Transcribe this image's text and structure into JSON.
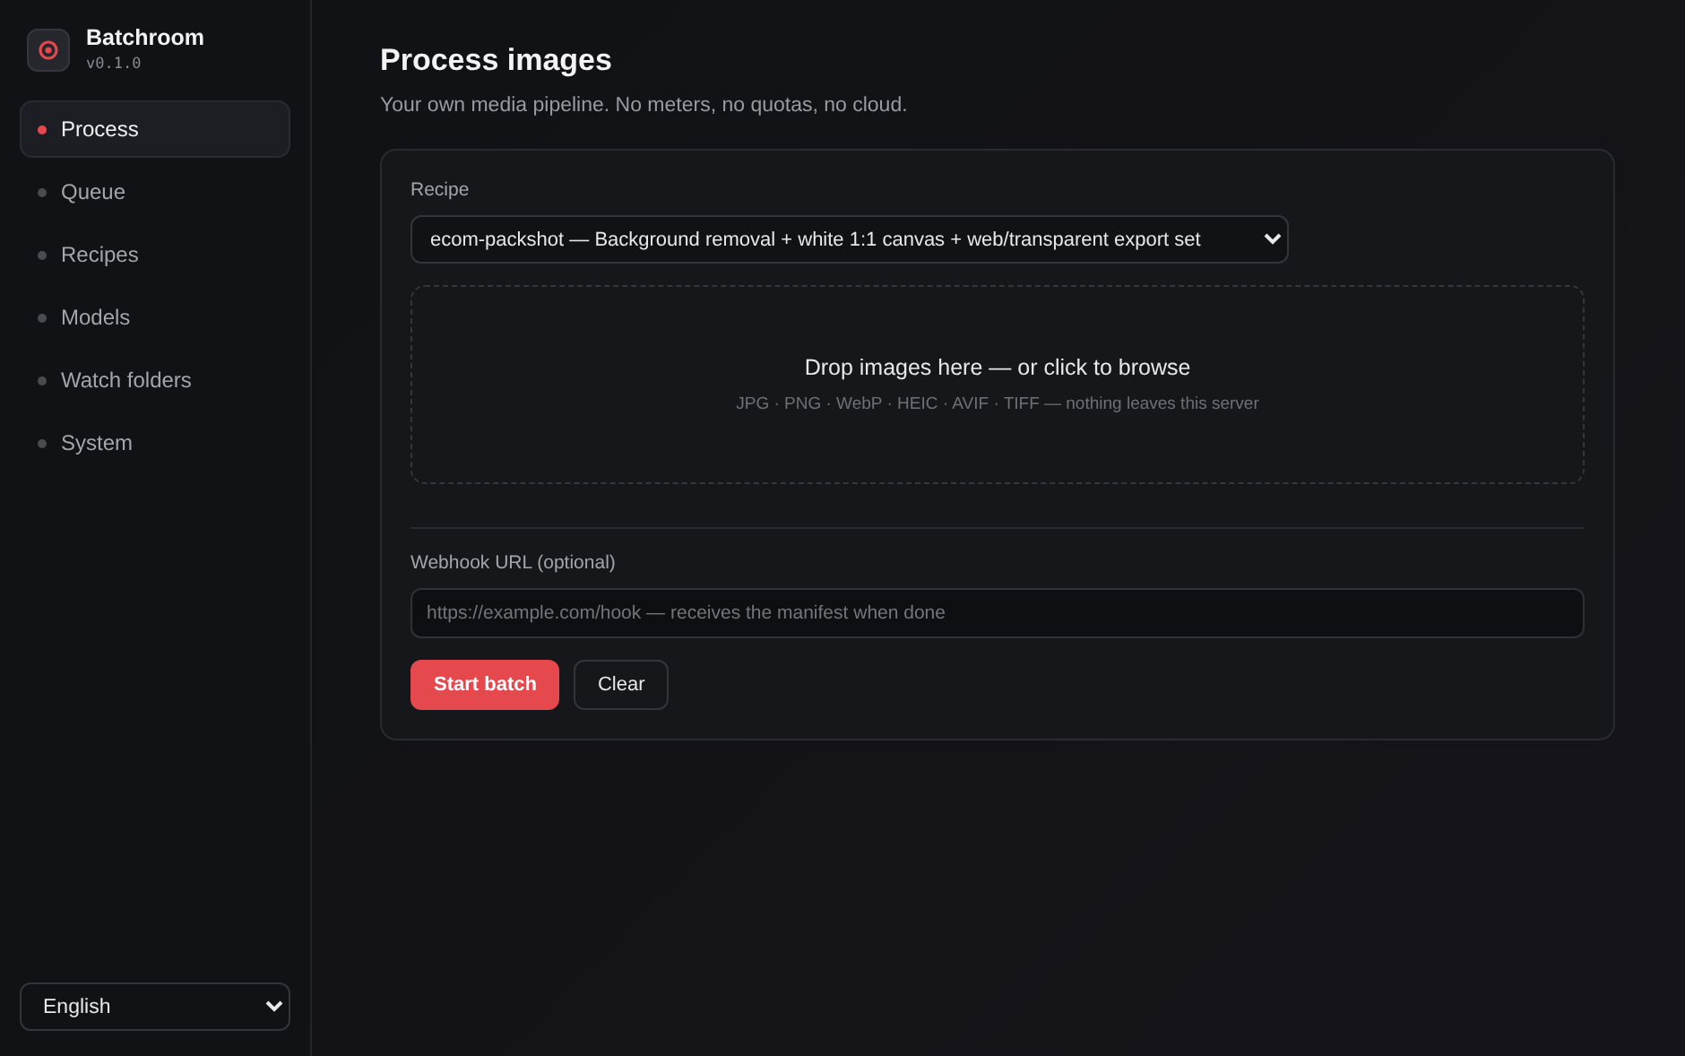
{
  "app": {
    "name": "Batchroom",
    "version": "v0.1.0"
  },
  "sidebar": {
    "items": [
      {
        "label": "Process",
        "selected": true
      },
      {
        "label": "Queue",
        "selected": false
      },
      {
        "label": "Recipes",
        "selected": false
      },
      {
        "label": "Models",
        "selected": false
      },
      {
        "label": "Watch folders",
        "selected": false
      },
      {
        "label": "System",
        "selected": false
      }
    ],
    "language": "English"
  },
  "page": {
    "title": "Process images",
    "subtitle": "Your own media pipeline. No meters, no quotas, no cloud."
  },
  "form": {
    "recipe_label": "Recipe",
    "recipe": "ecom-packshot — Background removal + white 1:1 canvas + web/transparent export set",
    "dropzone": {
      "title": "Drop images here — or click to browse",
      "hint": "JPG · PNG · WebP · HEIC · AVIF · TIFF — nothing leaves this server"
    },
    "webhook_label": "Webhook URL (optional)",
    "webhook_placeholder": "https://example.com/hook — receives the manifest when done",
    "buttons": [
      {
        "label": "Start batch",
        "kind": "primary"
      },
      {
        "label": "Clear",
        "kind": "secondary"
      }
    ]
  }
}
